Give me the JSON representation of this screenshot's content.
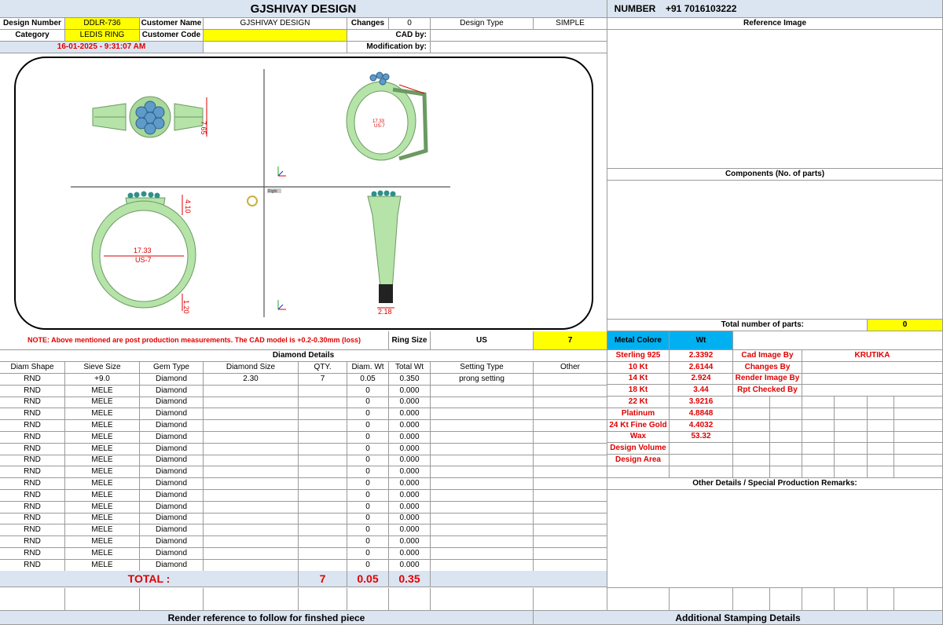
{
  "header": {
    "title": "GJSHIVAY DESIGN",
    "number_label": "NUMBER",
    "number_value": "+91 7016103222"
  },
  "info": {
    "design_number_label": "Design Number",
    "design_number": "DDLR-736",
    "customer_name_label": "Customer Name",
    "customer_name": "GJSHIVAY DESIGN",
    "changes_label": "Changes",
    "changes": "0",
    "design_type_label": "Design Type",
    "design_type": "SIMPLE",
    "category_label": "Category",
    "category": "LEDIS RING",
    "customer_code_label": "Customer Code",
    "customer_code": "",
    "cad_by_label": "CAD by:",
    "cad_by": "",
    "date": "16-01-2025 - 9:31:07 AM",
    "modification_label": "Modification by:",
    "modification": ""
  },
  "right_panel": {
    "reference_image": "Reference Image",
    "components": "Components (No. of parts)",
    "total_parts_label": "Total number of parts:",
    "total_parts": "0",
    "metal_colore": "Metal Colore",
    "wt": "Wt",
    "metals": [
      {
        "name": "Sterling 925",
        "wt": "2.3392"
      },
      {
        "name": "10 Kt",
        "wt": "2.6144"
      },
      {
        "name": "14 Kt",
        "wt": "2.924"
      },
      {
        "name": "18 Kt",
        "wt": "3.44"
      },
      {
        "name": "22 Kt",
        "wt": "3.9216"
      },
      {
        "name": "Platinum",
        "wt": "4.8848"
      },
      {
        "name": "24 Kt Fine Gold",
        "wt": "4.4032"
      },
      {
        "name": "Wax",
        "wt": "53.32"
      },
      {
        "name": "Design Volume",
        "wt": ""
      },
      {
        "name": "Design Area",
        "wt": ""
      }
    ],
    "by_fields": [
      {
        "label": "Cad Image By",
        "value": "KRUTIKA"
      },
      {
        "label": "Changes By",
        "value": ""
      },
      {
        "label": "Render Image By",
        "value": ""
      },
      {
        "label": "Rpt Checked By",
        "value": ""
      }
    ],
    "other_details": "Other Details / Special Production Remarks:"
  },
  "cad": {
    "dim_width": "7.65",
    "dim_inner": "17.33",
    "dim_size": "US-7",
    "dim_top": "4.10",
    "dim_bottom": "1.20",
    "dim_side": "2.18",
    "view_label": "Right"
  },
  "note": {
    "text": "NOTE: Above mentioned are post production measurements. The CAD model is +0.2-0.30mm (loss)",
    "ring_size_label": "Ring Size",
    "ring_size_unit": "US",
    "ring_size": "7"
  },
  "diamond": {
    "title": "Diamond Details",
    "columns": [
      "Diam Shape",
      "Sieve Size",
      "Gem Type",
      "Diamond Size",
      "QTY.",
      "Diam. Wt",
      "Total Wt",
      "Setting Type",
      "Other"
    ],
    "rows": [
      [
        "RND",
        "+9.0",
        "Diamond",
        "2.30",
        "7",
        "0.05",
        "0.350",
        "prong setting",
        ""
      ],
      [
        "RND",
        "MELE",
        "Diamond",
        "",
        "",
        "0",
        "0.000",
        "",
        ""
      ],
      [
        "RND",
        "MELE",
        "Diamond",
        "",
        "",
        "0",
        "0.000",
        "",
        ""
      ],
      [
        "RND",
        "MELE",
        "Diamond",
        "",
        "",
        "0",
        "0.000",
        "",
        ""
      ],
      [
        "RND",
        "MELE",
        "Diamond",
        "",
        "",
        "0",
        "0.000",
        "",
        ""
      ],
      [
        "RND",
        "MELE",
        "Diamond",
        "",
        "",
        "0",
        "0.000",
        "",
        ""
      ],
      [
        "RND",
        "MELE",
        "Diamond",
        "",
        "",
        "0",
        "0.000",
        "",
        ""
      ],
      [
        "RND",
        "MELE",
        "Diamond",
        "",
        "",
        "0",
        "0.000",
        "",
        ""
      ],
      [
        "RND",
        "MELE",
        "Diamond",
        "",
        "",
        "0",
        "0.000",
        "",
        ""
      ],
      [
        "RND",
        "MELE",
        "Diamond",
        "",
        "",
        "0",
        "0.000",
        "",
        ""
      ],
      [
        "RND",
        "MELE",
        "Diamond",
        "",
        "",
        "0",
        "0.000",
        "",
        ""
      ],
      [
        "RND",
        "MELE",
        "Diamond",
        "",
        "",
        "0",
        "0.000",
        "",
        ""
      ],
      [
        "RND",
        "MELE",
        "Diamond",
        "",
        "",
        "0",
        "0.000",
        "",
        ""
      ],
      [
        "RND",
        "MELE",
        "Diamond",
        "",
        "",
        "0",
        "0.000",
        "",
        ""
      ],
      [
        "RND",
        "MELE",
        "Diamond",
        "",
        "",
        "0",
        "0.000",
        "",
        ""
      ],
      [
        "RND",
        "MELE",
        "Diamond",
        "",
        "",
        "0",
        "0.000",
        "",
        ""
      ],
      [
        "RND",
        "MELE",
        "Diamond",
        "",
        "",
        "0",
        "0.000",
        "",
        ""
      ]
    ],
    "total_label": "TOTAL :",
    "total_qty": "7",
    "total_diam_wt": "0.05",
    "total_wt": "0.35"
  },
  "footer": {
    "render_ref": "Render reference to follow for finshed piece",
    "stamping": "Additional Stamping Details"
  }
}
